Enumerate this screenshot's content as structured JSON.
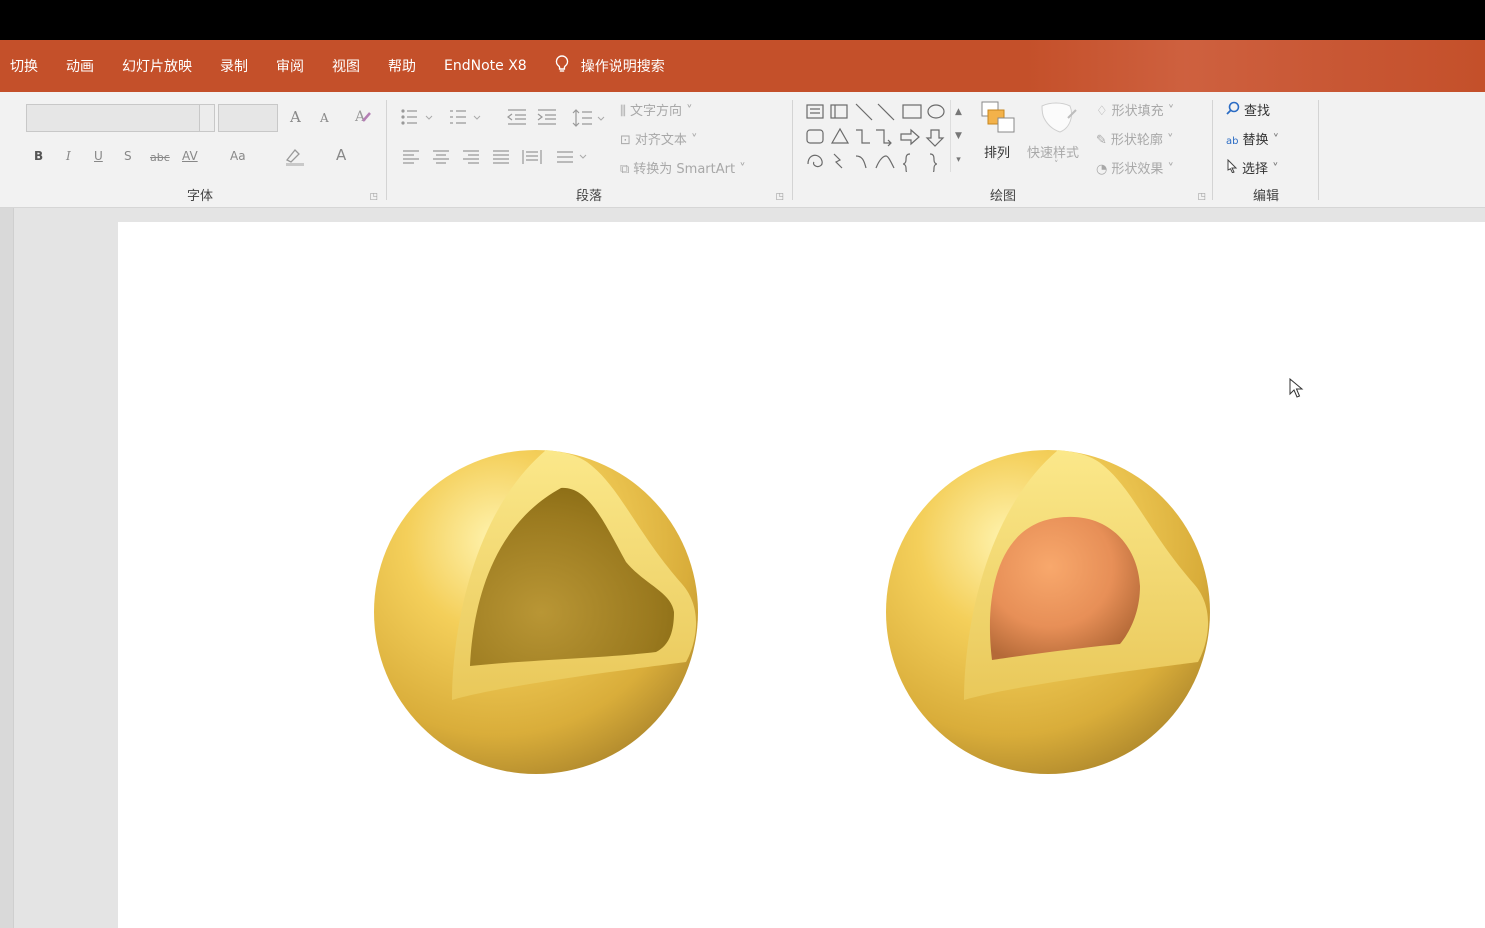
{
  "menu": {
    "tabs": [
      "切换",
      "动画",
      "幻灯片放映",
      "录制",
      "审阅",
      "视图",
      "帮助",
      "EndNote X8"
    ],
    "search_label": "操作说明搜索"
  },
  "ribbon": {
    "font_group": {
      "label": "字体",
      "buttons": {
        "grow": "A",
        "shrink": "A",
        "bold": "B",
        "italic": "I",
        "underline": "U",
        "shadow": "S",
        "strike": "abc",
        "spacing": "AV",
        "case": "Aa",
        "font_color": "A"
      }
    },
    "paragraph_group": {
      "label": "段落",
      "text_direction": "文字方向",
      "align_text": "对齐文本",
      "smartart": "转换为 SmartArt"
    },
    "drawing_group": {
      "label": "绘图",
      "arrange": "排列",
      "quick_styles": "快速样式",
      "shape_fill": "形状填充",
      "shape_outline": "形状轮廓",
      "shape_effects": "形状效果"
    },
    "editing_group": {
      "label": "编辑",
      "find": "查找",
      "replace": "替换",
      "select": "选择"
    }
  },
  "colors": {
    "menu_bar": "#c4502a",
    "ribbon": "#f2f2f2",
    "shell": "#e8c24a",
    "shell_inner": "#9e7d1e",
    "core": "#e9925a"
  },
  "icons": {
    "search": "lightbulb-icon",
    "find": "magnifier-icon",
    "replace": "replace-icon",
    "select": "arrow-pointer-icon"
  }
}
